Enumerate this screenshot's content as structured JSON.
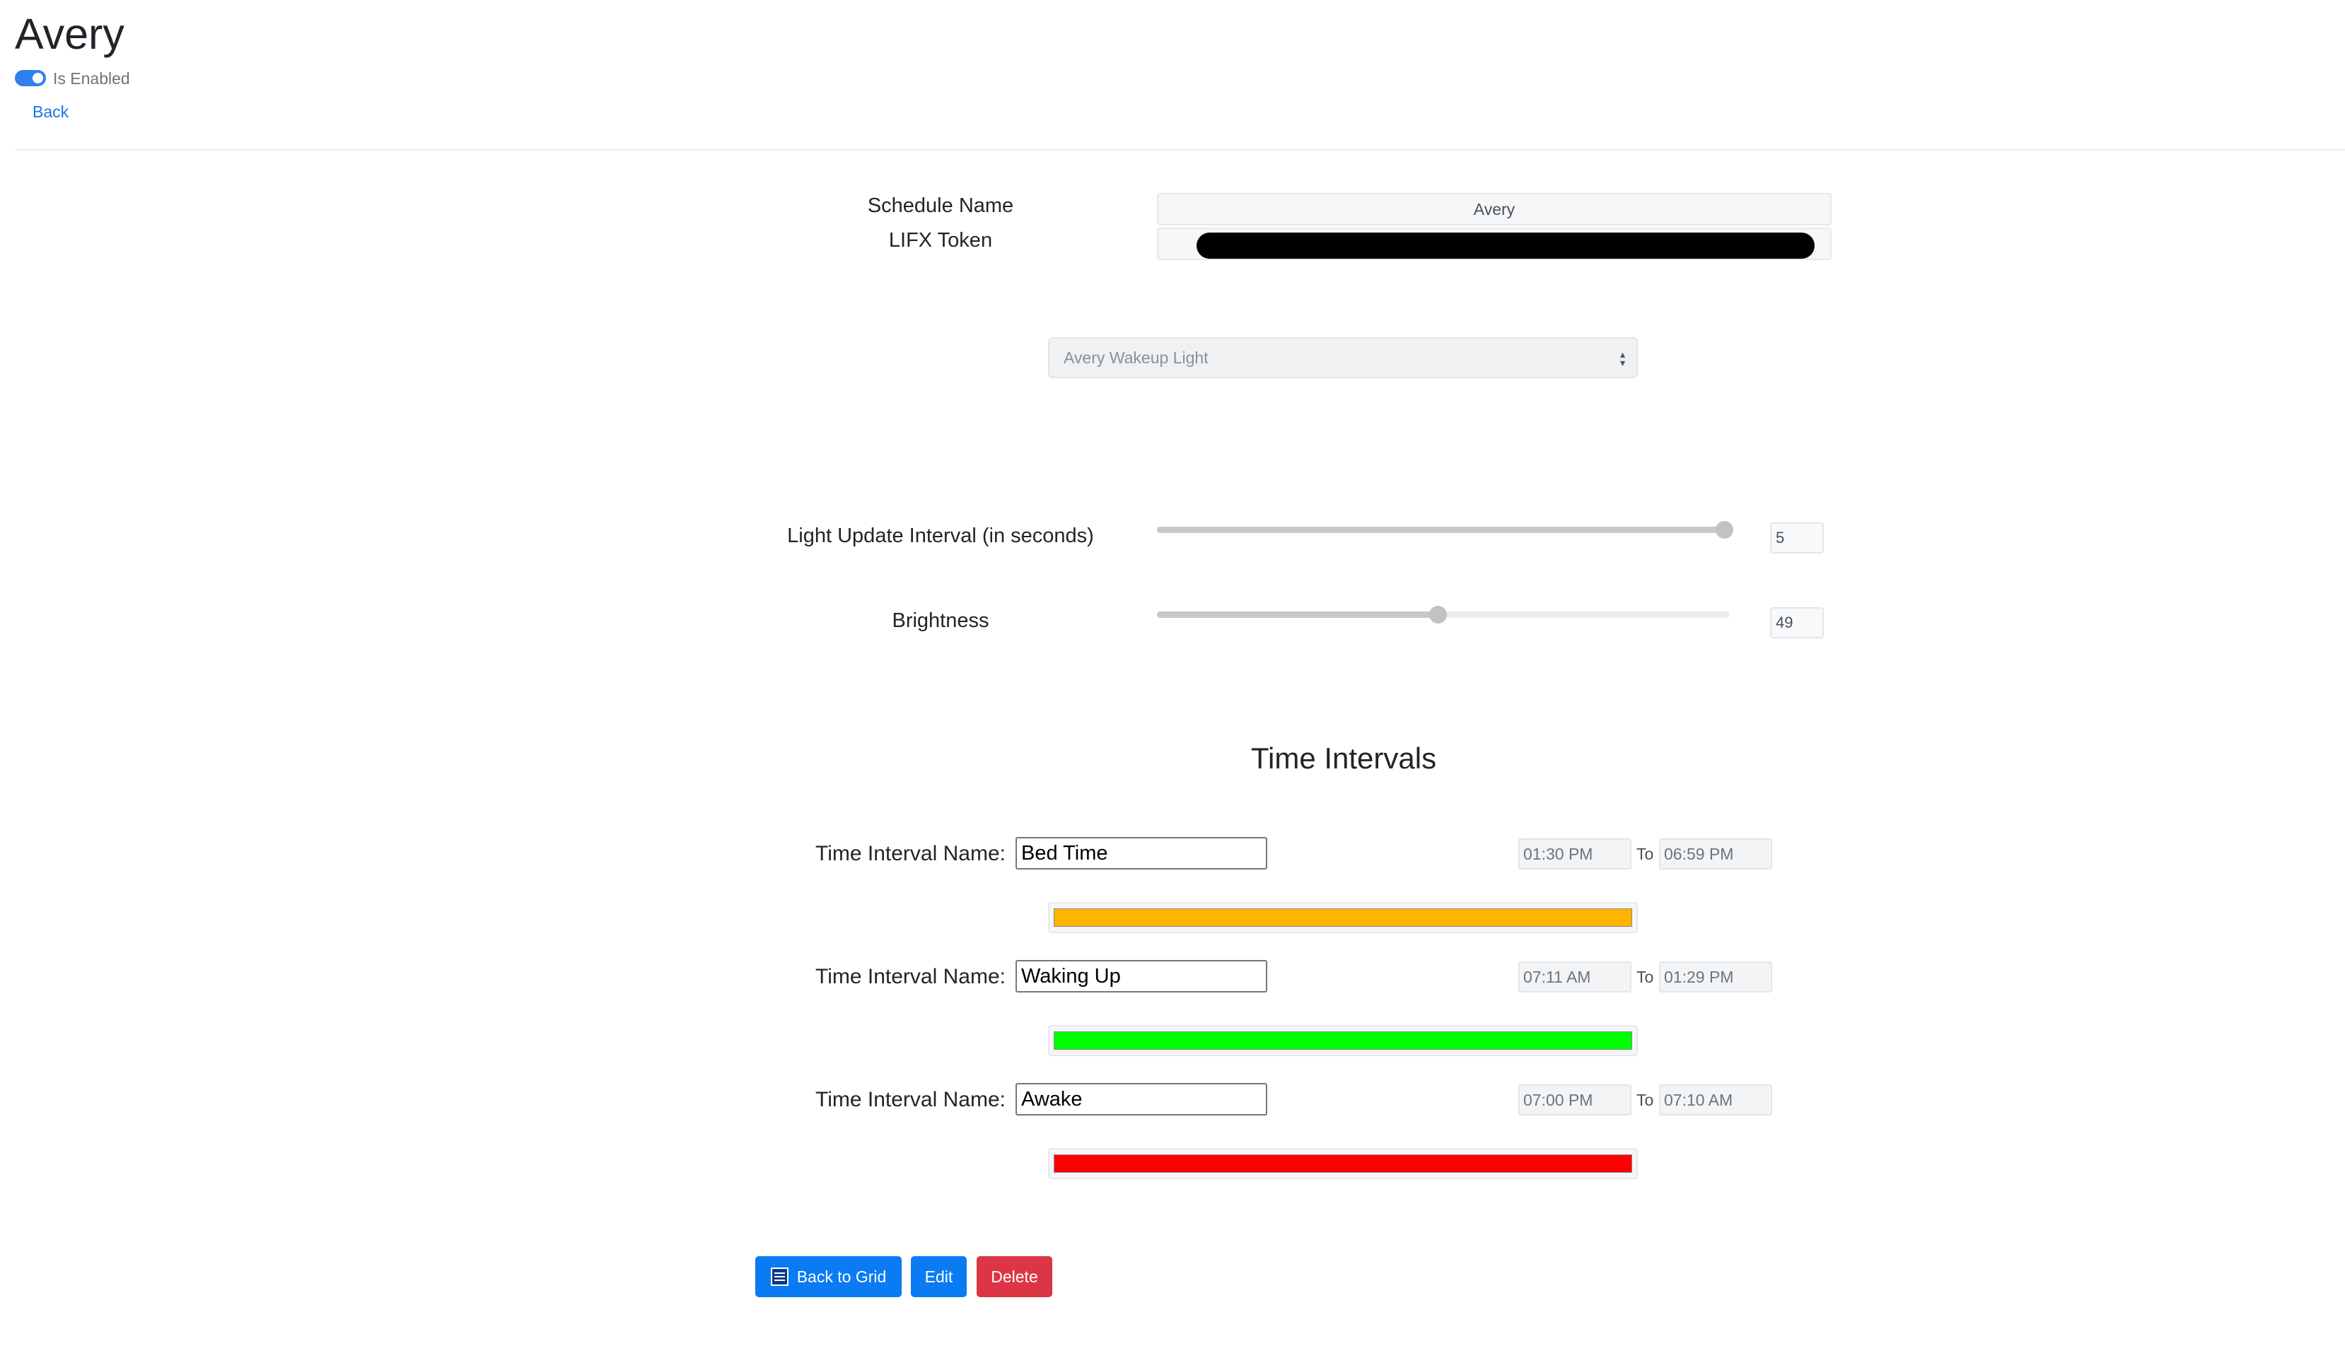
{
  "header": {
    "title": "Avery",
    "enabled_label": "Is Enabled",
    "enabled": true,
    "back_link": "Back"
  },
  "form": {
    "schedule_name_label": "Schedule Name",
    "schedule_name_value": "Avery",
    "lifx_token_label": "LIFX Token",
    "light_select_value": "Avery Wakeup Light",
    "update_interval_label": "Light Update Interval (in seconds)",
    "update_interval_value": "5",
    "update_interval_fraction": 0.99,
    "brightness_label": "Brightness",
    "brightness_value": "49",
    "brightness_fraction": 0.49
  },
  "time_intervals": {
    "title": "Time Intervals",
    "to_label": "To",
    "items": [
      {
        "label": "Time Interval Name:",
        "name": "Bed Time",
        "start": "01:30 PM",
        "end": "06:59 PM",
        "color": "#ffb400"
      },
      {
        "label": "Time Interval Name:",
        "name": "Waking Up",
        "start": "07:11 AM",
        "end": "01:29 PM",
        "color": "#00ff00"
      },
      {
        "label": "Time Interval Name:",
        "name": "Awake",
        "start": "07:00 PM",
        "end": "07:10 AM",
        "color": "#ff0000"
      }
    ]
  },
  "actions": {
    "back_to_grid": "Back to Grid",
    "edit": "Edit",
    "delete": "Delete"
  },
  "icons": {
    "back_to_grid": "grid-icon",
    "select": "select-caret-icon"
  }
}
